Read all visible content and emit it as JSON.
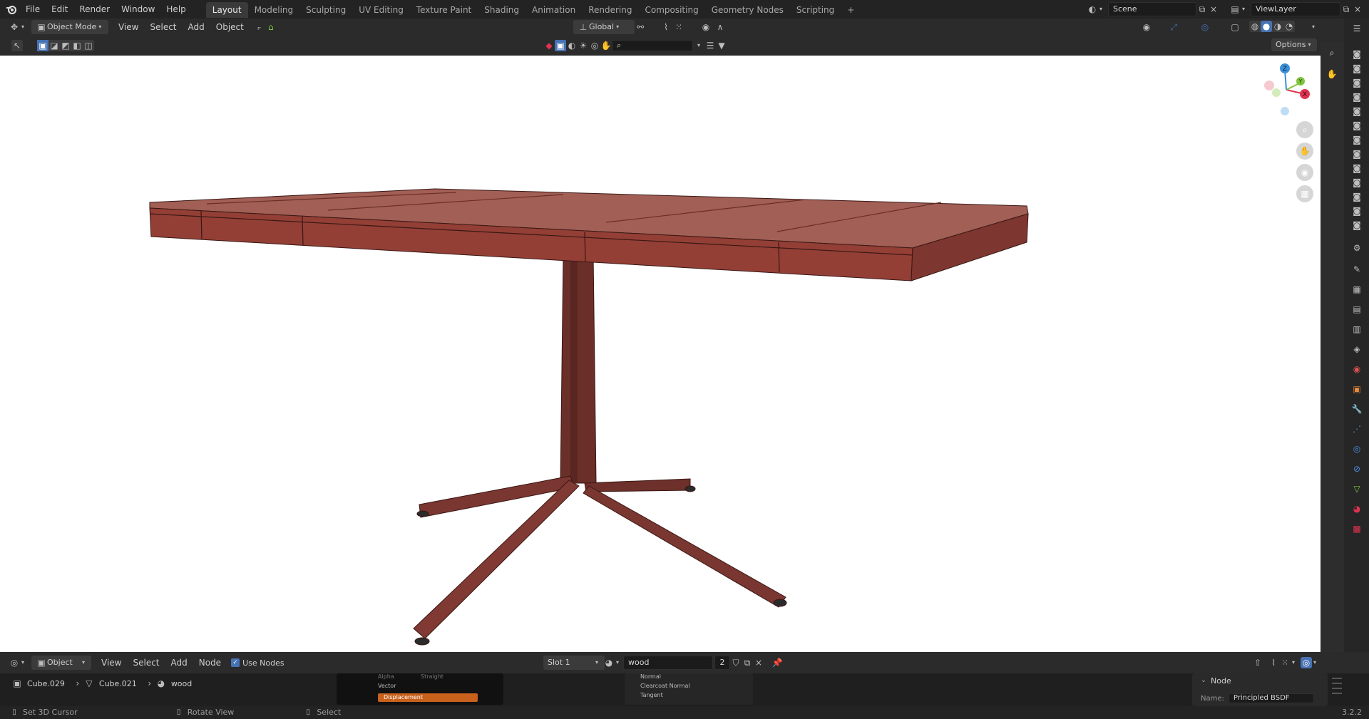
{
  "topbar": {
    "menus": [
      "File",
      "Edit",
      "Render",
      "Window",
      "Help"
    ],
    "workspaces": [
      "Layout",
      "Modeling",
      "Sculpting",
      "UV Editing",
      "Texture Paint",
      "Shading",
      "Animation",
      "Rendering",
      "Compositing",
      "Geometry Nodes",
      "Scripting"
    ],
    "active_workspace": "Layout",
    "add_workspace": "+",
    "scene": "Scene",
    "view_layer": "ViewLayer"
  },
  "viewport_header": {
    "mode": "Object Mode",
    "menus": [
      "View",
      "Select",
      "Add",
      "Object"
    ],
    "orientation": "Global",
    "options_label": "Options"
  },
  "gizmo": {
    "x": "X",
    "y": "Y",
    "z": "Z"
  },
  "node_editor": {
    "type": "Object",
    "menus": [
      "View",
      "Select",
      "Add",
      "Node"
    ],
    "use_nodes_label": "Use Nodes",
    "use_nodes_checked": true,
    "slot": "Slot 1",
    "material": "wood",
    "users": "2",
    "breadcrumb": [
      "Cube.029",
      "Cube.021",
      "wood"
    ],
    "node_rows_left": [
      "Alpha",
      "Straight",
      "Vector",
      "Displacement"
    ],
    "node_rows_right": [
      "Normal",
      "Clearcoat Normal",
      "Tangent"
    ],
    "side_panel": {
      "title": "Node",
      "name_label": "Name:",
      "name_value": "Principled BSDF"
    }
  },
  "statusbar": {
    "items": [
      "Set 3D Cursor",
      "Rotate View",
      "Select"
    ],
    "version": "3.2.2"
  },
  "colors": {
    "wood": "#8a3f35",
    "accent": "#4772b3",
    "gizmo_x": "#e0334f",
    "gizmo_y": "#7fc43e",
    "gizmo_z": "#3a8fd9"
  }
}
